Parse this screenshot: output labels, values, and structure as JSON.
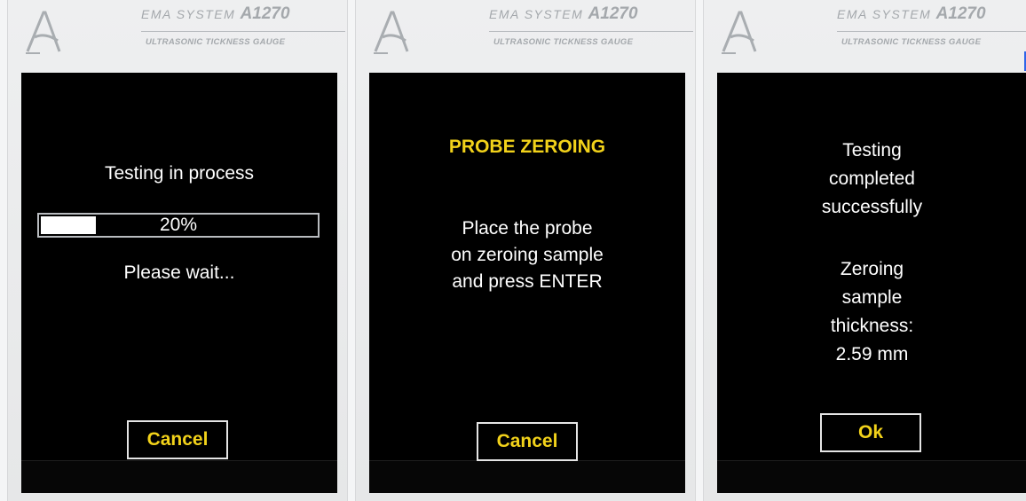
{
  "device": {
    "brand_prefix": "EMA SYSTEM",
    "model": "A1270",
    "subtitle": "ULTRASONIC TICKNESS GAUGE"
  },
  "screens": [
    {
      "title": "Testing in process",
      "progress": {
        "value_percent": 20,
        "label": "20%"
      },
      "message": "Please wait...",
      "button": "Cancel"
    },
    {
      "title": "PROBE ZEROING",
      "lines": [
        "Place the probe",
        "on zeroing sample",
        "and press ENTER"
      ],
      "button": "Cancel"
    },
    {
      "lines": [
        "Testing",
        "completed",
        "successfully"
      ],
      "detail": [
        "Zeroing",
        "sample",
        "thickness:",
        "2.59 mm"
      ],
      "button": "Ok"
    }
  ],
  "colors": {
    "screen_bg": "#000000",
    "accent_text": "#f2d21a",
    "body_text": "#ffffff",
    "bezel": "#e9eaeb"
  },
  "icons": {
    "logo": "stylized-a-logo-icon"
  }
}
